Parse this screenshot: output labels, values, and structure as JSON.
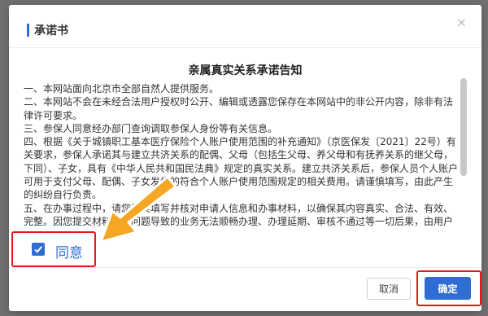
{
  "modal": {
    "title": "承诺书",
    "close_glyph": "×"
  },
  "document": {
    "title": "亲属真实关系承诺告知",
    "paragraphs": [
      "一、本网站面向北京市全部自然人提供服务。",
      "二、本网站不会在未经合法用户授权时公开、编辑或透露您保存在本网站中的非公开内容，除非有法律许可要求。",
      "三、参保人同意经办部门查询调取参保人身份等有关信息。",
      "四、根据《关于城镇职工基本医疗保险个人账户使用范围的补充通知》（京医保发〔2021〕22号）有关要求，参保人承诺其与建立共济关系的配偶、父母（包括生父母、养父母和有抚养关系的继父母，下同）、子女，具有《中华人民共和国民法典》规定的真实关系。建立共济关系后，参保人员个人账户可用于支付父母、配偶、子女发生的符合个人账户使用范围规定的相关费用。请谨慎填写，由此产生的纠纷自行负责。",
      "五、在办事过程中，请您如实填写并核对申请人信息和办事材料，以确保其内容真实、合法、有效、完整。因您提交材料存在问题导致的业务无法顺畅办理、办理延期、审核不通过等一切后果，由用户自"
    ]
  },
  "agree": {
    "label": "同意",
    "checked": true
  },
  "buttons": {
    "cancel": "取消",
    "confirm": "确定"
  },
  "colors": {
    "accent": "#2f6dd3",
    "highlight": "#e0191b",
    "arrow": "#f5a623"
  }
}
